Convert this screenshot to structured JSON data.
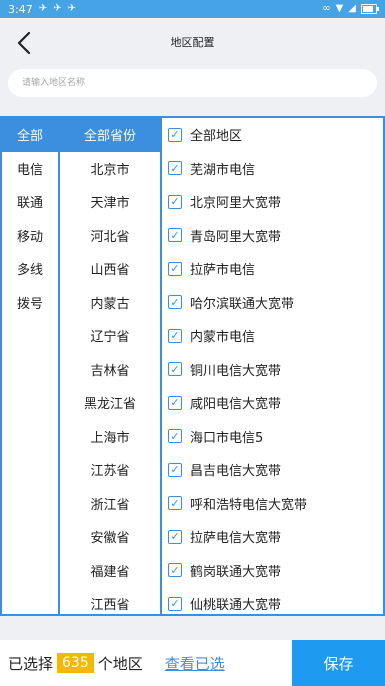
{
  "status_bar": {
    "time": "3:47"
  },
  "header": {
    "title": "地区配置"
  },
  "search": {
    "placeholder": "请输入地区名称"
  },
  "isp_types": [
    "全部",
    "电信",
    "联通",
    "移动",
    "多线",
    "拨号"
  ],
  "provinces": [
    "全部省份",
    "北京市",
    "天津市",
    "河北省",
    "山西省",
    "内蒙古",
    "辽宁省",
    "吉林省",
    "黑龙江省",
    "上海市",
    "江苏省",
    "浙江省",
    "安徽省",
    "福建省",
    "江西省"
  ],
  "areas": [
    "全部地区",
    "芜湖市电信",
    "北京阿里大宽带",
    "青岛阿里大宽带",
    "拉萨市电信",
    "哈尔滨联通大宽带",
    "内蒙市电信",
    "铜川电信大宽带",
    "咸阳电信大宽带",
    "海口市电信5",
    "昌吉电信大宽带",
    "呼和浩特电信大宽带",
    "拉萨电信大宽带",
    "鹤岗联通大宽带",
    "仙桃联通大宽带"
  ],
  "bottom": {
    "selected_prefix": "已选择",
    "selected_count": "635",
    "selected_suffix": "个地区",
    "view_selected": "查看已选",
    "save": "保存"
  },
  "colors": {
    "accent": "#3b8fde",
    "status_bar": "#46a3e6",
    "count_badge": "#f5b800",
    "save_button": "#1e9bf0"
  }
}
